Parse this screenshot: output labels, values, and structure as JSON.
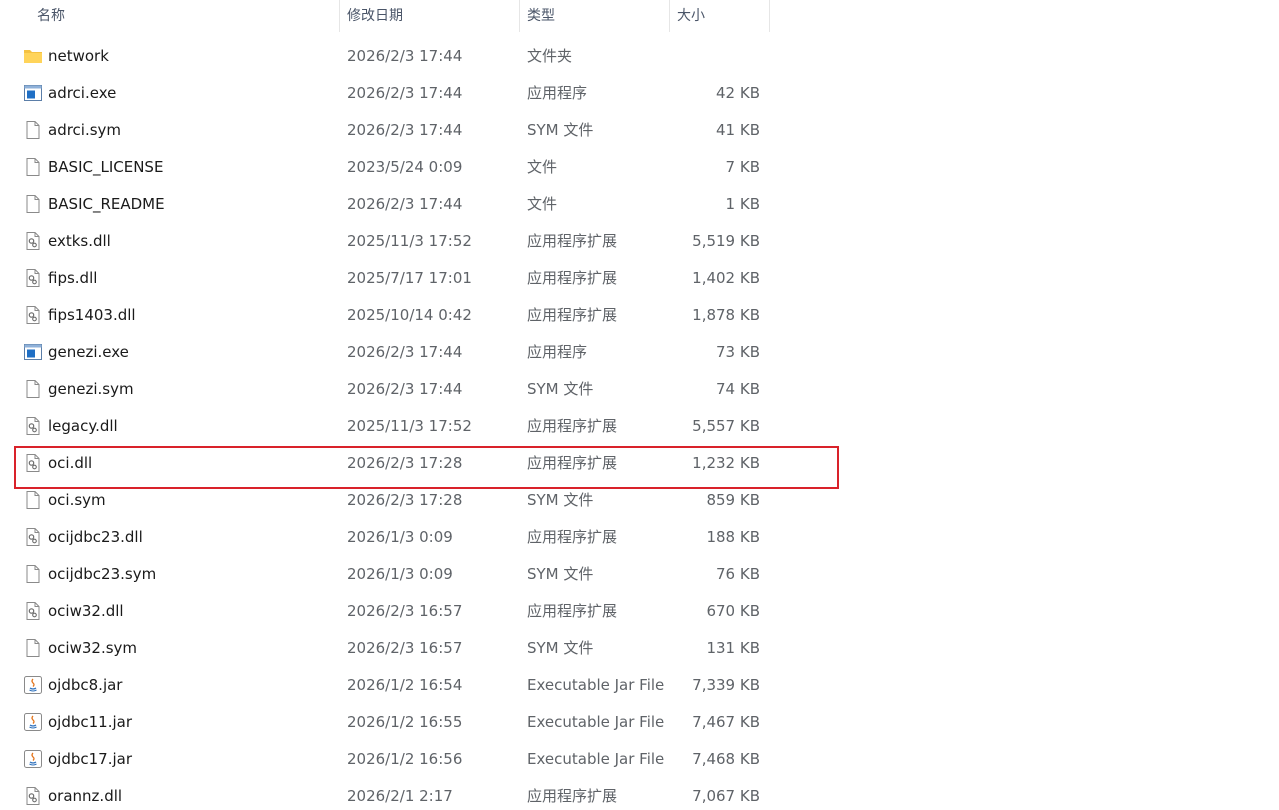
{
  "header": {
    "name": "名称",
    "date": "修改日期",
    "type": "类型",
    "size": "大小",
    "sort_arrow": "^"
  },
  "files": [
    {
      "name": "network",
      "date": "2026/2/3 17:44",
      "type": "文件夹",
      "size": "",
      "icon": "folder-icon"
    },
    {
      "name": "adrci.exe",
      "date": "2026/2/3 17:44",
      "type": "应用程序",
      "size": "42 KB",
      "icon": "exe-icon"
    },
    {
      "name": "adrci.sym",
      "date": "2026/2/3 17:44",
      "type": "SYM 文件",
      "size": "41 KB",
      "icon": "file-icon"
    },
    {
      "name": "BASIC_LICENSE",
      "date": "2023/5/24 0:09",
      "type": "文件",
      "size": "7 KB",
      "icon": "file-icon"
    },
    {
      "name": "BASIC_README",
      "date": "2026/2/3 17:44",
      "type": "文件",
      "size": "1 KB",
      "icon": "file-icon"
    },
    {
      "name": "extks.dll",
      "date": "2025/11/3 17:52",
      "type": "应用程序扩展",
      "size": "5,519 KB",
      "icon": "dll-icon"
    },
    {
      "name": "fips.dll",
      "date": "2025/7/17 17:01",
      "type": "应用程序扩展",
      "size": "1,402 KB",
      "icon": "dll-icon"
    },
    {
      "name": "fips1403.dll",
      "date": "2025/10/14 0:42",
      "type": "应用程序扩展",
      "size": "1,878 KB",
      "icon": "dll-icon"
    },
    {
      "name": "genezi.exe",
      "date": "2026/2/3 17:44",
      "type": "应用程序",
      "size": "73 KB",
      "icon": "exe-icon"
    },
    {
      "name": "genezi.sym",
      "date": "2026/2/3 17:44",
      "type": "SYM 文件",
      "size": "74 KB",
      "icon": "file-icon"
    },
    {
      "name": "legacy.dll",
      "date": "2025/11/3 17:52",
      "type": "应用程序扩展",
      "size": "5,557 KB",
      "icon": "dll-icon"
    },
    {
      "name": "oci.dll",
      "date": "2026/2/3 17:28",
      "type": "应用程序扩展",
      "size": "1,232 KB",
      "icon": "dll-icon"
    },
    {
      "name": "oci.sym",
      "date": "2026/2/3 17:28",
      "type": "SYM 文件",
      "size": "859 KB",
      "icon": "file-icon"
    },
    {
      "name": "ocijdbc23.dll",
      "date": "2026/1/3 0:09",
      "type": "应用程序扩展",
      "size": "188 KB",
      "icon": "dll-icon"
    },
    {
      "name": "ocijdbc23.sym",
      "date": "2026/1/3 0:09",
      "type": "SYM 文件",
      "size": "76 KB",
      "icon": "file-icon"
    },
    {
      "name": "ociw32.dll",
      "date": "2026/2/3 16:57",
      "type": "应用程序扩展",
      "size": "670 KB",
      "icon": "dll-icon"
    },
    {
      "name": "ociw32.sym",
      "date": "2026/2/3 16:57",
      "type": "SYM 文件",
      "size": "131 KB",
      "icon": "file-icon"
    },
    {
      "name": "ojdbc8.jar",
      "date": "2026/1/2 16:54",
      "type": "Executable Jar File",
      "size": "7,339 KB",
      "icon": "jar-icon"
    },
    {
      "name": "ojdbc11.jar",
      "date": "2026/1/2 16:55",
      "type": "Executable Jar File",
      "size": "7,467 KB",
      "icon": "jar-icon"
    },
    {
      "name": "ojdbc17.jar",
      "date": "2026/1/2 16:56",
      "type": "Executable Jar File",
      "size": "7,468 KB",
      "icon": "jar-icon"
    },
    {
      "name": "orannz.dll",
      "date": "2026/2/1 2:17",
      "type": "应用程序扩展",
      "size": "7,067 KB",
      "icon": "dll-icon"
    }
  ],
  "highlighted_file": "oci.dll",
  "colors": {
    "highlight_border": "#d9222a",
    "folder": "#f5c242",
    "exe_accent": "#1f6fc5"
  }
}
